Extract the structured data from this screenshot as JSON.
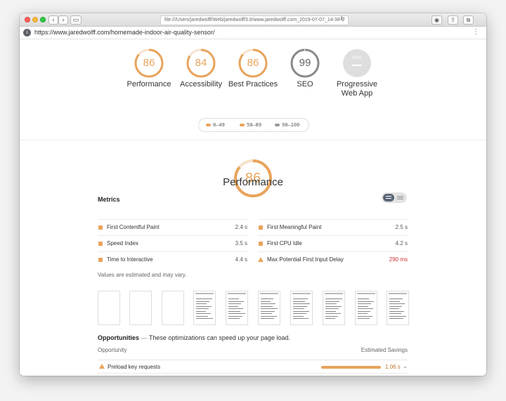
{
  "colors": {
    "average": "#e8a45c",
    "pass": "#a0a0a0",
    "fail": "#e8a45c",
    "pwa_gray": "#dedede"
  },
  "browser": {
    "url_field": "file:///Users/jaredwolff/Web/jaredwolff3.0/www.jaredwolff.com_2019-07-07_14-38-0",
    "page_url": "https://www.jaredwolff.com/homemade-indoor-air-quality-sensor/"
  },
  "gauges": [
    {
      "label": "Performance",
      "score": "86",
      "value": 86,
      "color": "#e8a45c"
    },
    {
      "label": "Accessibility",
      "score": "84",
      "value": 84,
      "color": "#e8a45c"
    },
    {
      "label": "Best Practices",
      "score": "86",
      "value": 86,
      "color": "#e8a45c"
    },
    {
      "label": "SEO",
      "score": "99",
      "value": 99,
      "color": "#8a8a8a"
    },
    {
      "label": "Progressive Web App",
      "label_line1": "Progressive",
      "label_line2": "Web App",
      "score": "PWA",
      "value": 0,
      "color": "#cccccc"
    }
  ],
  "legend": [
    {
      "range": "0–49",
      "color": "#e8a45c"
    },
    {
      "range": "50–89",
      "color": "#e8a45c"
    },
    {
      "range": "90–100",
      "color": "#999999"
    }
  ],
  "performance": {
    "score": "86",
    "value": 86,
    "title": "Performance"
  },
  "metrics": {
    "title": "Metrics",
    "left": [
      {
        "label": "First Contentful Paint",
        "value": "2.4 s",
        "icon": "square"
      },
      {
        "label": "Speed Index",
        "value": "3.5 s",
        "icon": "square"
      },
      {
        "label": "Time to Interactive",
        "value": "4.4 s",
        "icon": "square"
      }
    ],
    "right": [
      {
        "label": "First Meaningful Paint",
        "value": "2.5 s",
        "icon": "square"
      },
      {
        "label": "First CPU Idle",
        "value": "4.2 s",
        "icon": "square"
      },
      {
        "label": "Max Potential First Input Delay",
        "value": "290 ms",
        "icon": "triangle"
      }
    ],
    "note": "Values are estimated and may vary."
  },
  "opportunities": {
    "title": "Opportunities",
    "description": "These optimizations can speed up your page load.",
    "col_opportunity": "Opportunity",
    "col_savings": "Estimated Savings",
    "rows": [
      {
        "label": "Preload key requests",
        "savings": "1.06 s",
        "fraction": 0.9
      }
    ]
  }
}
